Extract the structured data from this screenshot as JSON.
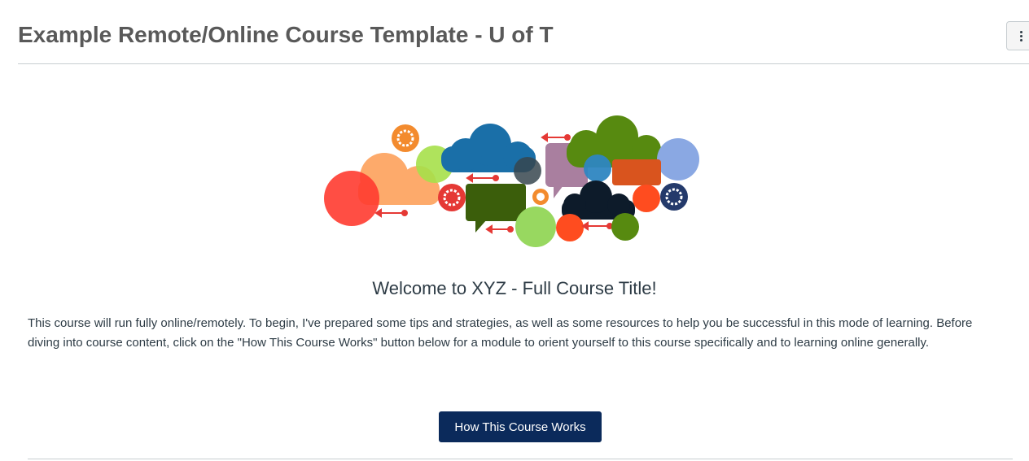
{
  "header": {
    "title": "Example Remote/Online Course Template - U of T",
    "options_icon": "kebab-vertical-icon"
  },
  "banner": {
    "icon": "cloud-collage-illustration",
    "colors": [
      "#fa7b3c",
      "#1e6fa8",
      "#5a8a1c",
      "#e83a2f",
      "#a8e063",
      "#a57c9b",
      "#0d1b2a",
      "#8aa8e3",
      "#3b5e0b",
      "#d9541e",
      "#243a6b"
    ]
  },
  "content": {
    "heading": "Welcome to XYZ - Full Course Title!",
    "intro": "This course will run fully online/remotely. To begin, I've prepared some tips and strategies, as well as some resources to help you be successful in this mode of learning. Before diving into course content, click on the \"How This Course Works\" button below for a module to orient yourself to this course specifically and to learning online generally.",
    "button_label": "How This Course Works",
    "button_color": "#0b2a5b"
  }
}
